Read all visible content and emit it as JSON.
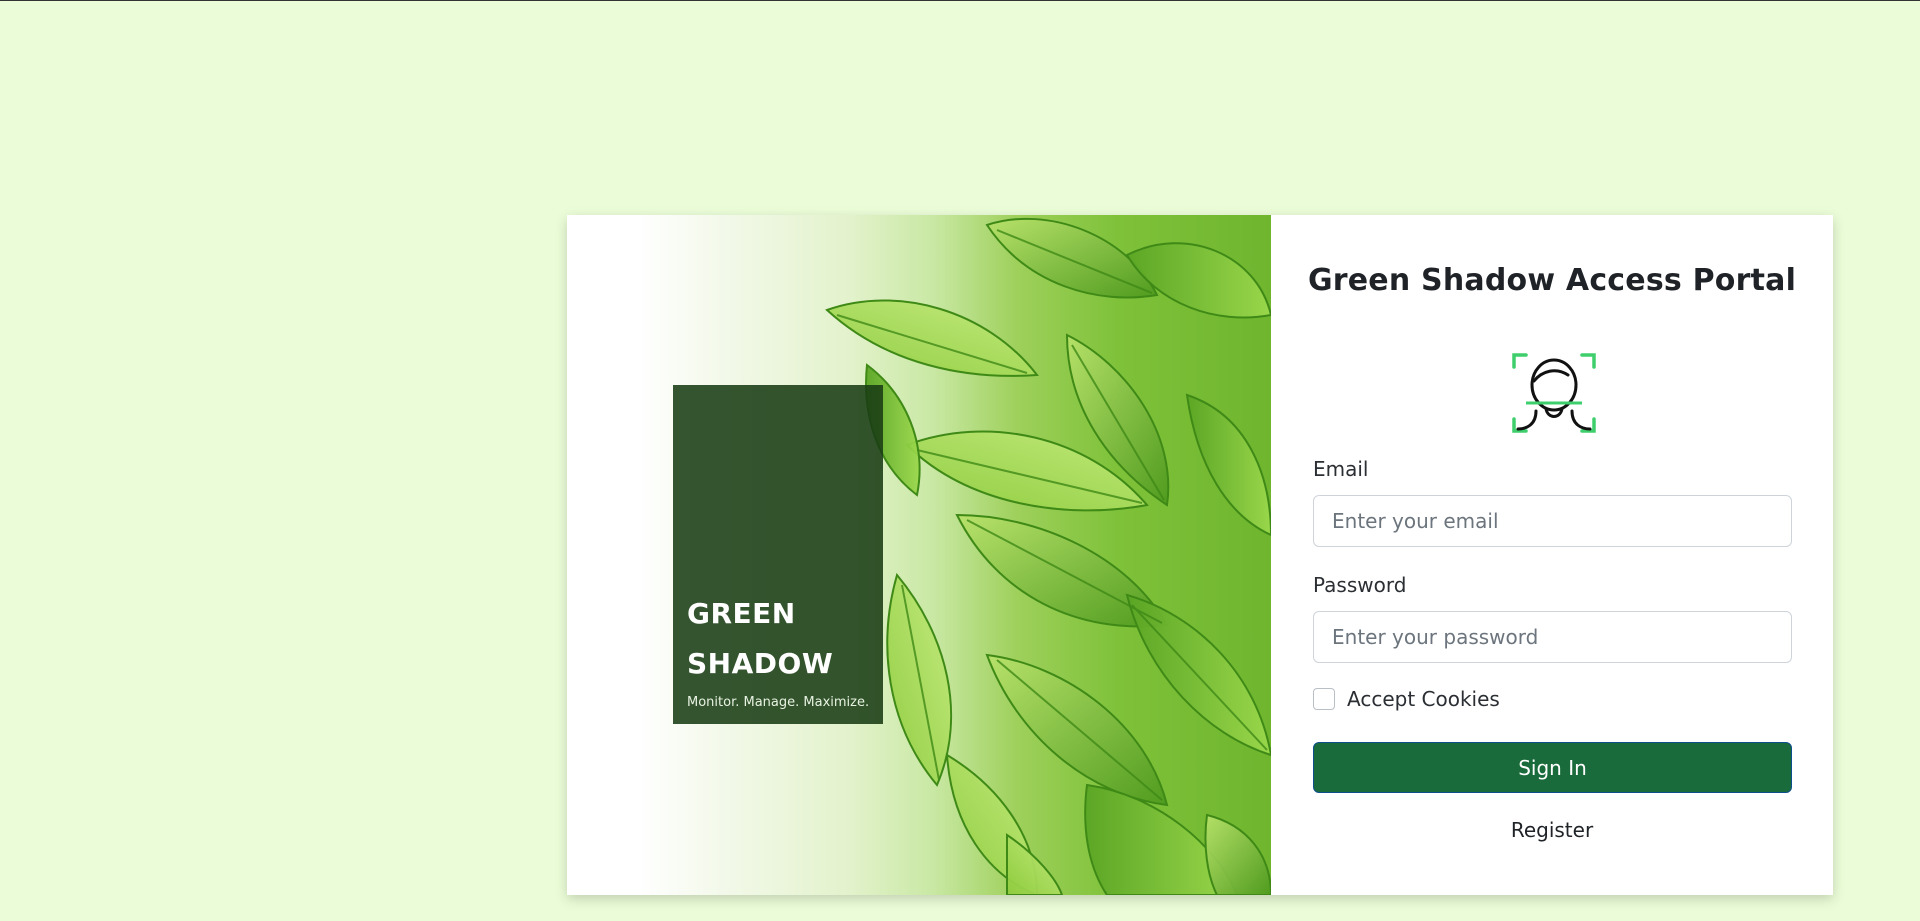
{
  "brand": {
    "name": "GREEN\nSHADOW",
    "tagline": "Monitor. Manage. Maximize."
  },
  "form": {
    "title": "Green Shadow Access Portal",
    "icon": "face-scan-icon",
    "email": {
      "label": "Email",
      "placeholder": "Enter your email",
      "value": ""
    },
    "password": {
      "label": "Password",
      "placeholder": "Enter your password",
      "value": ""
    },
    "cookies": {
      "label": "Accept Cookies",
      "checked": false
    },
    "signin_label": "Sign In",
    "register_label": "Register"
  },
  "colors": {
    "page_background": "#ebfdd8",
    "brand_box": "#1e4a1a",
    "primary_button": "#1a6b3b",
    "icon_accent": "#3ecf6c"
  }
}
